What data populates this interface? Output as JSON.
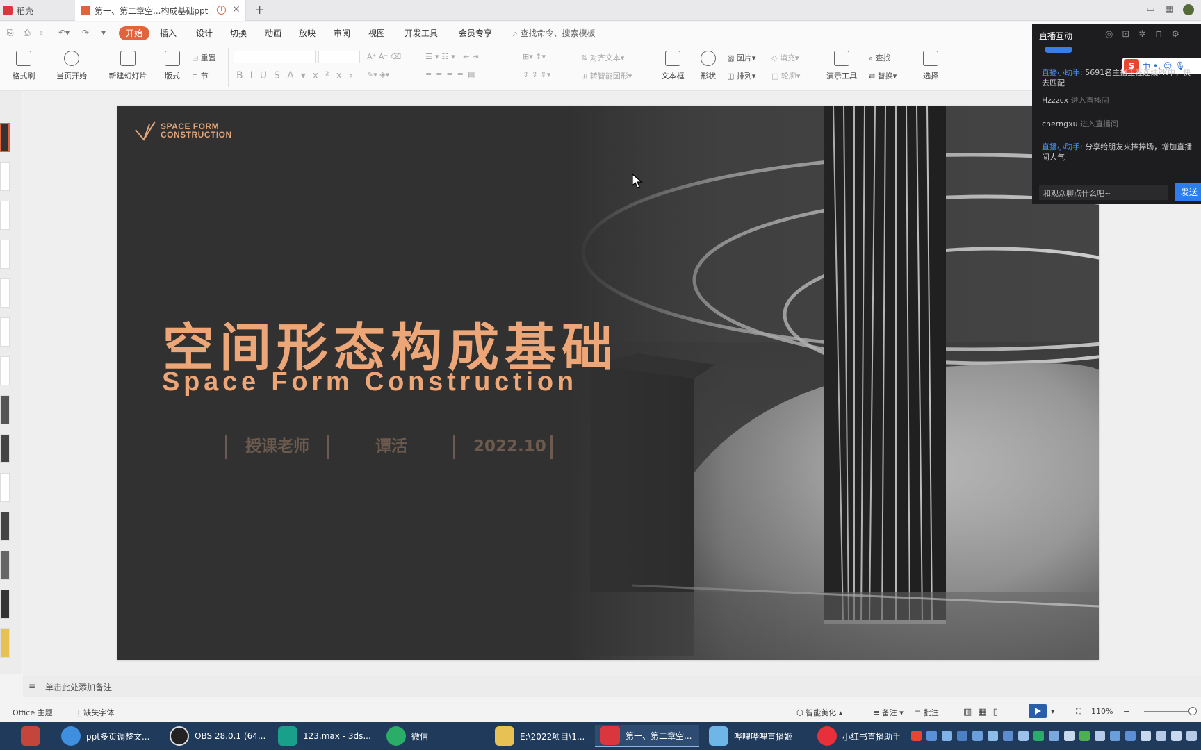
{
  "tabs": [
    {
      "label": "稻壳",
      "color": "#d9363e"
    },
    {
      "label": "第一、第二章空...构成基础ppt",
      "color": "#e0643a"
    }
  ],
  "menu": {
    "start": "开始",
    "items": [
      "插入",
      "设计",
      "切换",
      "动画",
      "放映",
      "审阅",
      "视图",
      "开发工具",
      "会员专享"
    ],
    "search_placeholder": "查找命令、搜索模板"
  },
  "ribbon": {
    "format_painter": "格式刷",
    "from_current": "当页开始",
    "new_slide": "新建幻灯片",
    "layout": "版式",
    "reset": "重置",
    "section": "节",
    "align_text": "对齐文本",
    "smart_graphic": "转智能图形",
    "textbox": "文本框",
    "shape": "形状",
    "picture": "图片",
    "arrange": "排列",
    "fill": "填充",
    "outline": "轮廓",
    "presenter_tools": "演示工具",
    "find": "查找",
    "replace": "替换",
    "select": "选择"
  },
  "slide": {
    "logo_line1": "SPACE FORM",
    "logo_line2": "CONSTRUCTION",
    "title": "空间形态构成基础",
    "subtitle": "Space Form Construction",
    "teacher_label": "授课老师",
    "teacher_name": "谭活",
    "date": "2022.10"
  },
  "notes_placeholder": "单击此处添加备注",
  "status": {
    "theme": "Office 主题",
    "missing_fonts": "缺失字体",
    "beautify": "智能美化",
    "notes": "备注",
    "comments": "批注",
    "zoom": "110%"
  },
  "live": {
    "header": "直播互动",
    "messages": [
      {
        "who": "直播小助手:",
        "text": "5691名主播正在连线PK中，快去匹配",
        "action": ""
      },
      {
        "who": "Hzzzcx",
        "text": "",
        "action": "进入直播间"
      },
      {
        "who": "cherngxu",
        "text": "",
        "action": "进入直播间"
      },
      {
        "who": "直播小助手:",
        "text": "分享给朋友来捧捧场，增加直播间人气",
        "action": ""
      }
    ],
    "input_placeholder": "和观众聊点什么吧~",
    "send": "发送",
    "ime": "中"
  },
  "taskbar": [
    {
      "label": "",
      "color": "#c4453c"
    },
    {
      "label": "ppt多页调整文...",
      "color": "#3f8fe0"
    },
    {
      "label": "OBS 28.0.1 (64...",
      "color": "#222222"
    },
    {
      "label": "123.max - 3ds...",
      "color": "#1a9f8a"
    },
    {
      "label": "微信",
      "color": "#2aae67"
    },
    {
      "label": "E:\\2022项目\\1...",
      "color": "#e8c154"
    },
    {
      "label": "第一、第二章空...",
      "color": "#d9363e"
    },
    {
      "label": "哔哩哔哩直播姬",
      "color": "#6fb6e8"
    },
    {
      "label": "小红书直播助手",
      "color": "#e8303a"
    }
  ],
  "colors": {
    "accent": "#e0653f",
    "slide_bg": "#323131",
    "title_orange": "#eda677",
    "meta_brown": "#6b5a4d",
    "taskbar": "#1f3a5a",
    "live_bg": "#1d1d1f"
  }
}
